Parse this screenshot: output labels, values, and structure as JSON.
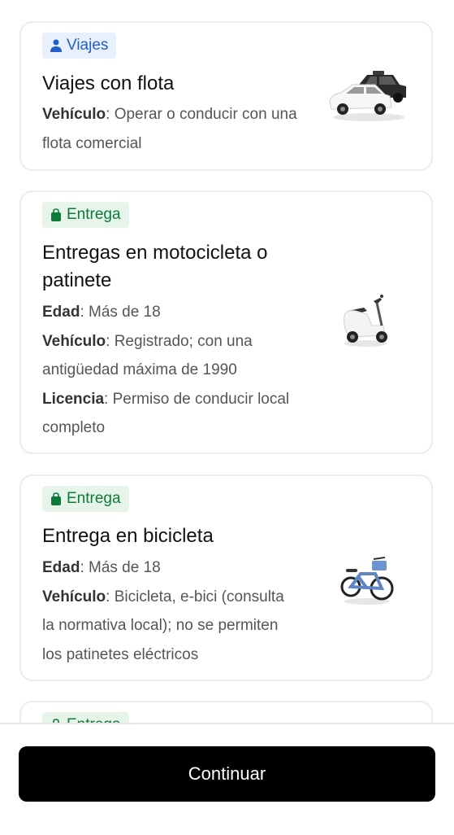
{
  "cards": [
    {
      "badge": "Viajes",
      "badge_icon": "person-icon",
      "title": "Viajes con flota",
      "lines": [
        {
          "label": "Vehículo",
          "text": ": Operar o conducir con una"
        },
        {
          "text": "flota comercial"
        }
      ],
      "image": "cars-illustration"
    },
    {
      "badge": "Entrega",
      "badge_icon": "shopping-bag-icon",
      "title_line1": "Entregas en motocicleta o",
      "title_line2": "patinete",
      "lines": [
        {
          "label": "Edad",
          "text": ": Más de 18"
        },
        {
          "label": "Vehículo",
          "text": ": Registrado; con una"
        },
        {
          "text": "antigüedad máxima de 1990"
        },
        {
          "label": "Licencia",
          "text": ": Permiso de conducir local"
        },
        {
          "text": "completo"
        }
      ],
      "image": "scooter-illustration"
    },
    {
      "badge": "Entrega",
      "badge_icon": "shopping-bag-icon",
      "title": "Entrega en bicicleta",
      "lines": [
        {
          "label": "Edad",
          "text": ": Más de 18"
        },
        {
          "label": "Vehículo",
          "text": ": Bicicleta, e-bici (consulta"
        },
        {
          "text": "la normativa local); no se permiten"
        },
        {
          "text": "los patinetes eléctricos"
        }
      ],
      "image": "bicycle-illustration"
    },
    {
      "badge": "Entrega",
      "badge_icon": "shopping-bag-icon"
    }
  ],
  "footer": {
    "button_label": "Continuar"
  },
  "colors": {
    "blue_badge_bg": "#e9f0fd",
    "blue_badge_text": "#1f5fc7",
    "green_badge_bg": "#e6f4ea",
    "green_badge_text": "#0e7a3a",
    "button_bg": "#000000"
  }
}
